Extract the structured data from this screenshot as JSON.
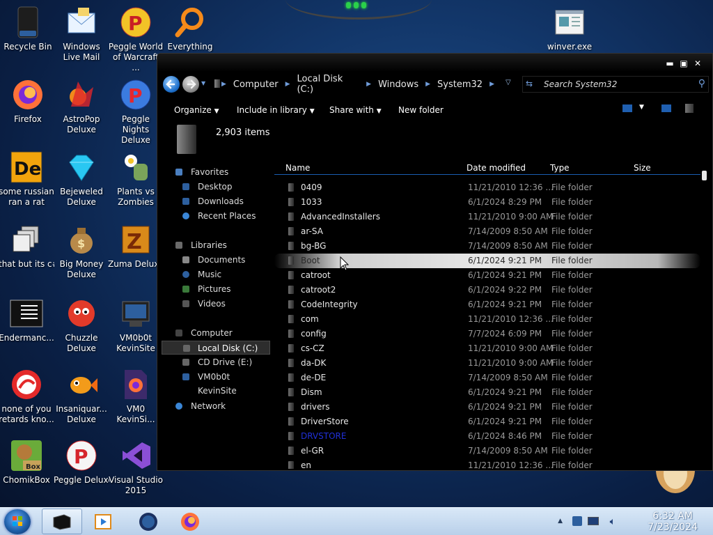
{
  "desktop": {
    "icons": [
      {
        "label": "Recycle Bin"
      },
      {
        "label": "Windows Live Mail"
      },
      {
        "label": "Peggle World of Warcraft ..."
      },
      {
        "label": "Everything"
      },
      {
        "label": "winver.exe"
      },
      {
        "label": "Firefox"
      },
      {
        "label": "AstroPop Deluxe"
      },
      {
        "label": "Peggle Nights Deluxe"
      },
      {
        "label": "some russian ran a rat"
      },
      {
        "label": "Bejeweled Deluxe"
      },
      {
        "label": "Plants vs Zombies"
      },
      {
        "label": "that but its c#"
      },
      {
        "label": "Big Money Deluxe"
      },
      {
        "label": "Zuma Deluxe"
      },
      {
        "label": "Endermanc..."
      },
      {
        "label": "Chuzzle Deluxe"
      },
      {
        "label": "VM0b0t KevinSite"
      },
      {
        "label": "none of you retards kno..."
      },
      {
        "label": "Insaniquar... Deluxe"
      },
      {
        "label": "VM0 KevinSi..."
      },
      {
        "label": "ChomikBox"
      },
      {
        "label": "Peggle Deluxe"
      },
      {
        "label": "Visual Studio 2015"
      }
    ]
  },
  "explorer": {
    "breadcrumb": [
      "Computer",
      "Local Disk (C:)",
      "Windows",
      "System32"
    ],
    "search_placeholder": "Search System32",
    "toolbar": {
      "organize": "Organize",
      "include_in_library": "Include in library",
      "share_with": "Share with",
      "new_folder": "New folder"
    },
    "details": {
      "item_count": "2,903 items"
    },
    "nav": {
      "favorites": "Favorites",
      "desktop": "Desktop",
      "downloads": "Downloads",
      "recent_places": "Recent Places",
      "libraries": "Libraries",
      "documents": "Documents",
      "music": "Music",
      "pictures": "Pictures",
      "videos": "Videos",
      "computer": "Computer",
      "local_disk": "Local Disk (C:)",
      "cd_drive": "CD Drive (E:)",
      "vm_site": "VM0b0t KevinSite",
      "network": "Network"
    },
    "columns": {
      "name": "Name",
      "date_modified": "Date modified",
      "type": "Type",
      "size": "Size"
    },
    "files": [
      {
        "name": "0409",
        "date": "11/21/2010 12:36 ...",
        "type": "File folder"
      },
      {
        "name": "1033",
        "date": "6/1/2024 8:29 PM",
        "type": "File folder"
      },
      {
        "name": "AdvancedInstallers",
        "date": "11/21/2010 9:00 AM",
        "type": "File folder"
      },
      {
        "name": "ar-SA",
        "date": "7/14/2009 8:50 AM",
        "type": "File folder"
      },
      {
        "name": "bg-BG",
        "date": "7/14/2009 8:50 AM",
        "type": "File folder"
      },
      {
        "name": "Boot",
        "date": "6/1/2024 9:21 PM",
        "type": "File folder"
      },
      {
        "name": "catroot",
        "date": "6/1/2024 9:21 PM",
        "type": "File folder"
      },
      {
        "name": "catroot2",
        "date": "6/1/2024 9:22 PM",
        "type": "File folder"
      },
      {
        "name": "CodeIntegrity",
        "date": "6/1/2024 9:21 PM",
        "type": "File folder"
      },
      {
        "name": "com",
        "date": "11/21/2010 12:36 ...",
        "type": "File folder"
      },
      {
        "name": "config",
        "date": "7/7/2024 6:09 PM",
        "type": "File folder"
      },
      {
        "name": "cs-CZ",
        "date": "11/21/2010 9:00 AM",
        "type": "File folder"
      },
      {
        "name": "da-DK",
        "date": "11/21/2010 9:00 AM",
        "type": "File folder"
      },
      {
        "name": "de-DE",
        "date": "7/14/2009 8:50 AM",
        "type": "File folder"
      },
      {
        "name": "Dism",
        "date": "6/1/2024 9:21 PM",
        "type": "File folder"
      },
      {
        "name": "drivers",
        "date": "6/1/2024 9:21 PM",
        "type": "File folder"
      },
      {
        "name": "DriverStore",
        "date": "6/1/2024 9:21 PM",
        "type": "File folder"
      },
      {
        "name": "DRVSTORE",
        "date": "6/1/2024 8:46 PM",
        "type": "File folder"
      },
      {
        "name": "el-GR",
        "date": "7/14/2009 8:50 AM",
        "type": "File folder"
      },
      {
        "name": "en",
        "date": "11/21/2010 12:36 ...",
        "type": "File folder"
      }
    ]
  },
  "taskbar": {
    "clock_time": "6:32 AM",
    "clock_date": "7/23/2024"
  },
  "colors": {
    "accent_blue": "#1a5eb1",
    "highlight_row": "#e0e0e0",
    "compressed_folder_text": "#2030d8"
  }
}
